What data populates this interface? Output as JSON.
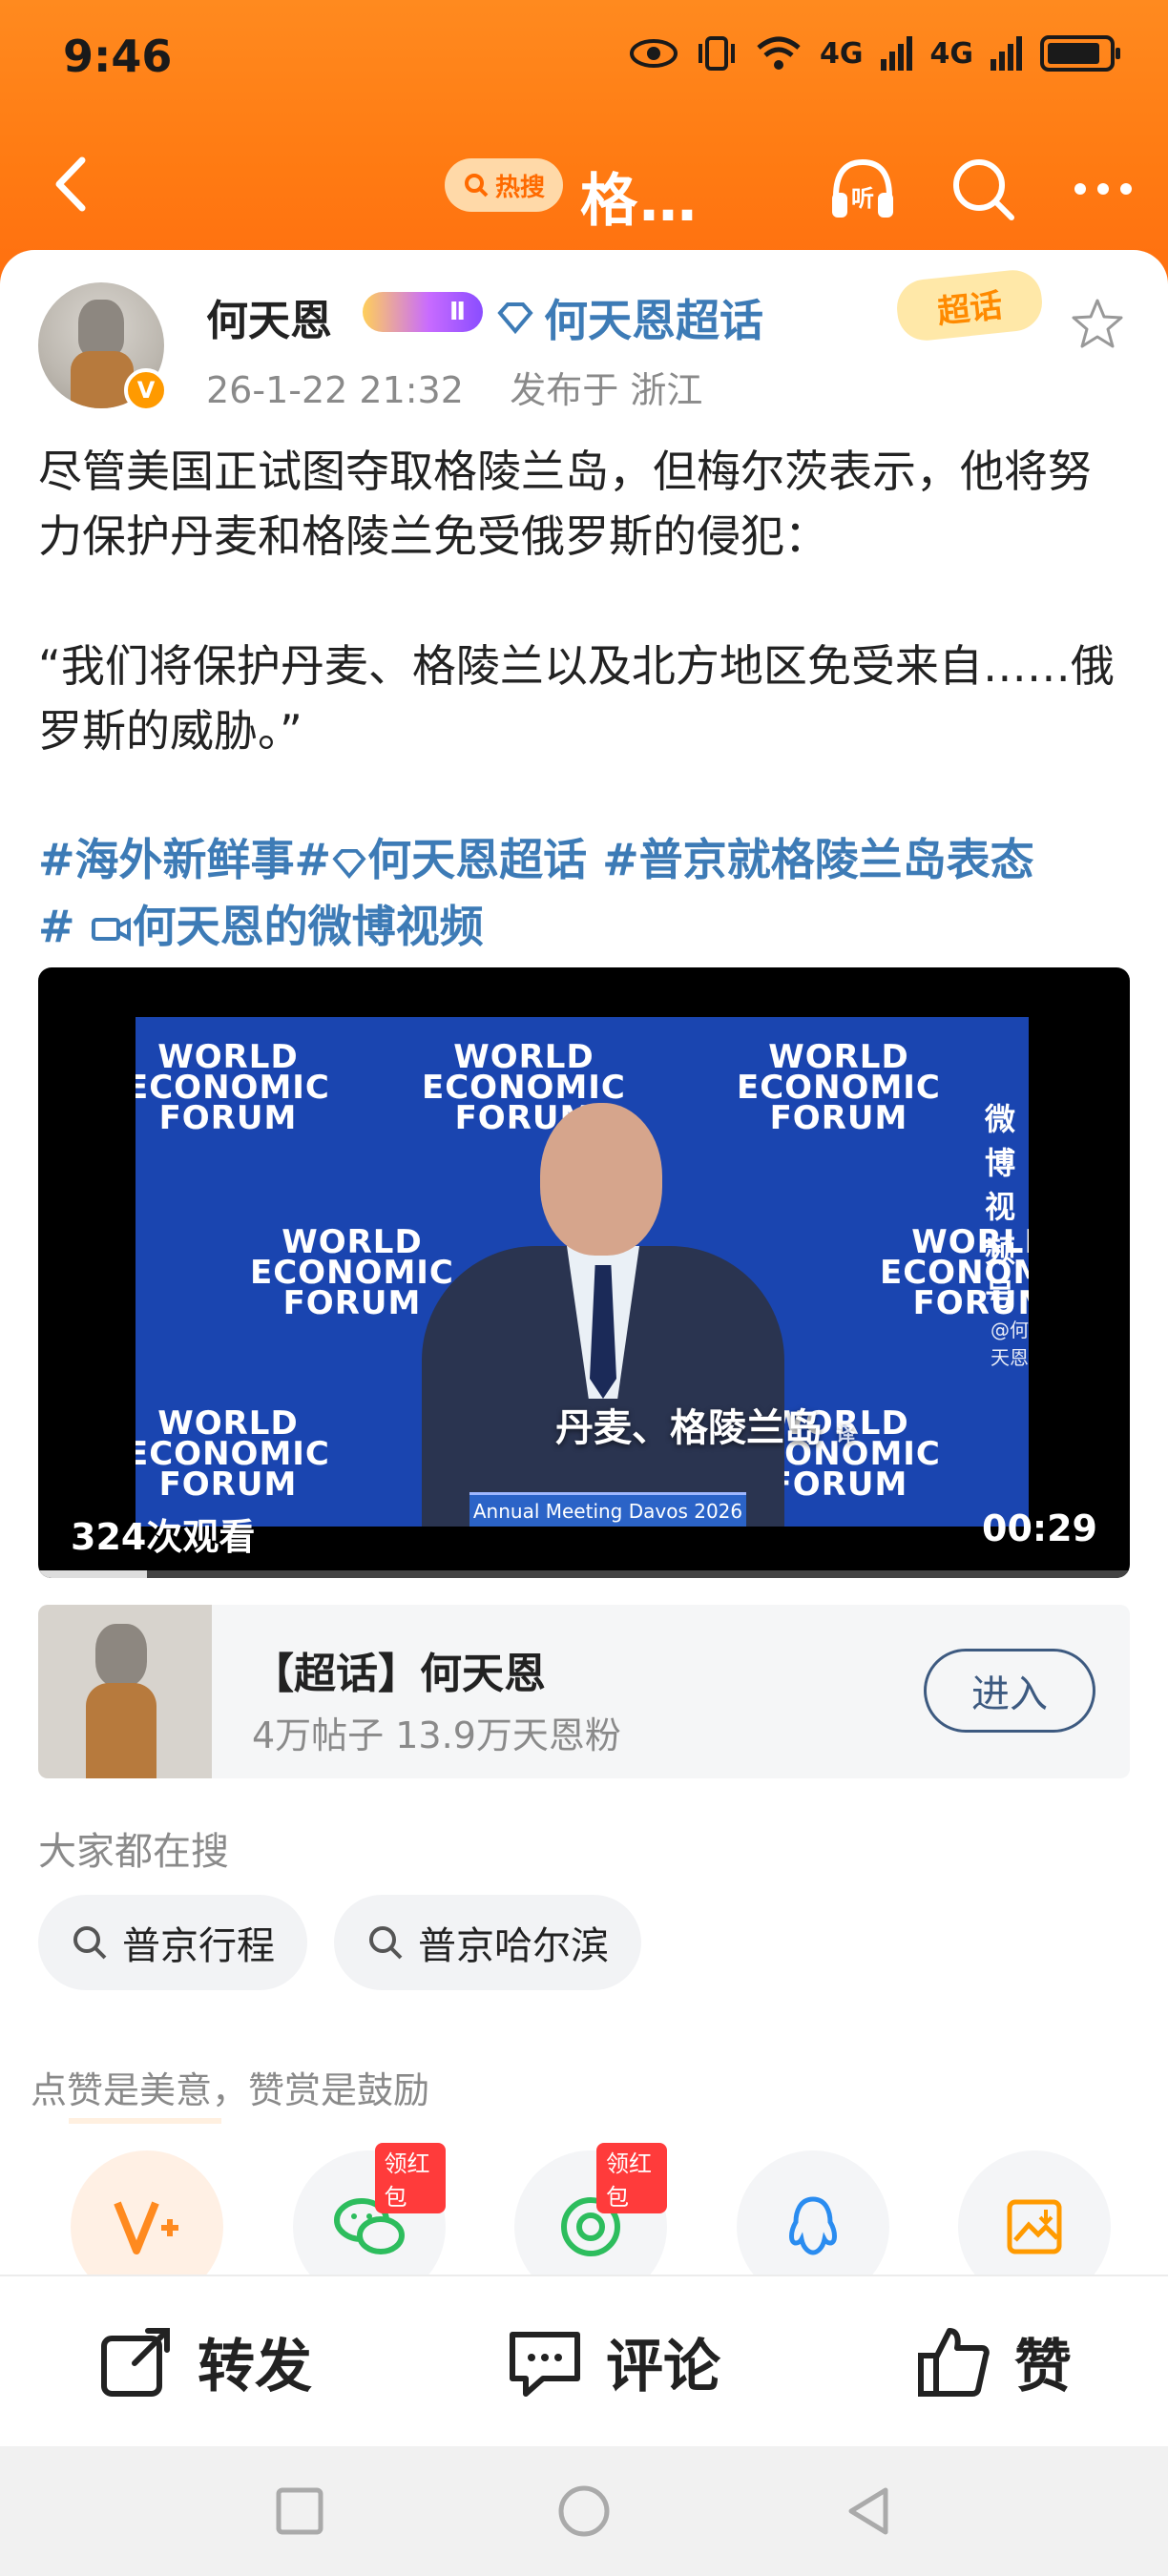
{
  "status_bar": {
    "time": "9:46",
    "network_label_1": "4G",
    "network_label_2": "4G"
  },
  "nav": {
    "hot_search_label": "热搜",
    "title": "格…",
    "listen_label": "听"
  },
  "author": {
    "name": "何天恩",
    "level": "Ⅱ",
    "super_topic_link": "何天恩超话",
    "date": "26-1-22 21:32",
    "location_prefix": "发布于",
    "location": "浙江",
    "chaohua_badge": "超话"
  },
  "post": {
    "line1": "尽管美国正试图夺取格陵兰岛，但梅尔茨表示，他将努力保护丹麦和格陵兰免受俄罗斯的侵犯：",
    "line2": "“我们将保护丹麦、格陵兰以及北方地区免受来自……俄罗斯的威胁。”",
    "topics_line1": "#海外新鲜事#",
    "topics_super": "何天恩超话",
    "topics_line1_b": " #普京就格陵兰岛表态",
    "topics_line2_hash": "#",
    "topics_video": "何天恩的微博视频"
  },
  "video": {
    "wef_text": [
      "WORLD",
      "ECONOMIC",
      "FORUM"
    ],
    "subtitle": "丹麦、格陵兰岛",
    "translate_mark": "译",
    "podium_text": "Annual Meeting Davos 2026",
    "watermark": "微博视频号",
    "watermark_sub": "@何天恩",
    "views": "324次观看",
    "duration": "00:29",
    "progress": 0.1
  },
  "super_card": {
    "title": "【超话】何天恩",
    "stats": "4万帖子 13.9万天恩粉",
    "enter_label": "进入"
  },
  "search_section": {
    "title": "大家都在搜",
    "chips": [
      "普京行程",
      "普京哈尔滨"
    ]
  },
  "reward": {
    "title": "点赞是美意，赞赏是鼓励",
    "redpack_label": "领红包"
  },
  "actions": {
    "repost": "转发",
    "comment": "评论",
    "like": "赞"
  },
  "colors": {
    "accent": "#ff7a12",
    "link": "#3d7bb6"
  }
}
